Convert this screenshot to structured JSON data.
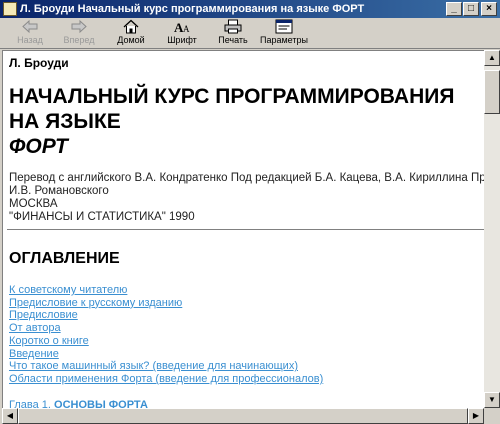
{
  "window": {
    "title": "Л. Броуди  Начальный курс программирования на языке ФОРТ",
    "buttons": {
      "minimize": "_",
      "maximize": "□",
      "close": "×"
    }
  },
  "toolbar": {
    "back": "Назад",
    "forward": "Вперед",
    "home": "Домой",
    "font": "Шрифт",
    "print": "Печать",
    "options": "Параметры"
  },
  "document": {
    "author": "Л. Броуди",
    "title_line1": "НАЧАЛЬНЫЙ КУРС ПРОГРАММИРОВАНИЯ",
    "title_line2": "НА ЯЗЫКЕ",
    "title_line3": "ФОРТ",
    "imprint_line1": "Перевод с английского В.А. Кондратенко Под редакцией Б.А. Кацева, В.А. Кириллина Предис",
    "imprint_line2": "И.В. Романовского",
    "imprint_line3": "МОСКВА",
    "imprint_line4": "\"ФИНАНСЫ И СТАТИСТИКА\" 1990",
    "toc_heading": "ОГЛАВЛЕНИЕ",
    "toc_links": [
      "К советскому читателю",
      "Предисловие к русскому изданию",
      "Предисловие",
      "От автора",
      "Коротко о книге",
      "Введение",
      "Что такое машинный язык? (введение для начинающих)",
      "Области применения Форта (введение для профессионалов)"
    ],
    "chapter_prefix": "Глава 1.",
    "chapter_title": "ОСНОВЫ ФОРТА"
  },
  "scrollbars": {
    "up": "▲",
    "down": "▼",
    "left": "◀",
    "right": "▶"
  }
}
